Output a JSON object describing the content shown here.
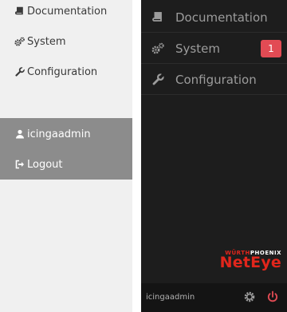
{
  "light_menu": {
    "items": [
      {
        "label": "Documentation",
        "icon": "book-icon"
      },
      {
        "label": "System",
        "icon": "gears-icon"
      },
      {
        "label": "Configuration",
        "icon": "wrench-icon"
      }
    ],
    "user_section": {
      "username": "icingaadmin",
      "logout_label": "Logout"
    },
    "colors": {
      "background": "#f0f0f0",
      "user_background": "#8c8c8c"
    }
  },
  "dark_menu": {
    "items": [
      {
        "label": "Documentation",
        "icon": "book-icon"
      },
      {
        "label": "System",
        "icon": "gears-icon",
        "badge": "1"
      },
      {
        "label": "Configuration",
        "icon": "wrench-icon"
      }
    ],
    "brand": {
      "prefix": "WÜRTH",
      "suffix": "PHOENIX",
      "product": "NetEye"
    },
    "footer": {
      "username": "icingaadmin",
      "settings_icon": "gear-icon",
      "logout_icon": "power-icon"
    },
    "colors": {
      "background": "#1d1d1d",
      "badge": "#e24b54",
      "brand_red": "#e1261c",
      "logout_icon": "#e24b54"
    }
  }
}
